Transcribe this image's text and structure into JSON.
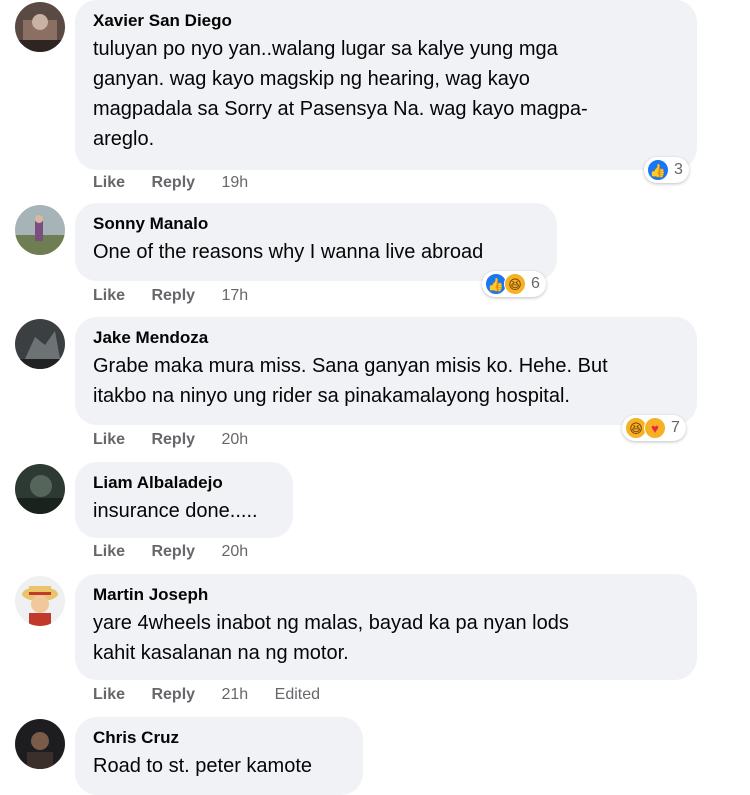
{
  "comments": [
    {
      "author": "Xavier San Diego",
      "text": "tuluyan po nyo yan..walang lugar sa kalye yung mga\nganyan. wag kayo magskip ng hearing, wag kayo\nmagpadala sa Sorry at Pasensya Na. wag kayo magpa-\nareglo.",
      "like": "Like",
      "reply": "Reply",
      "time": "19h",
      "edited": "",
      "reactions": {
        "icons": [
          "like-icon"
        ],
        "count": "3"
      }
    },
    {
      "author": "Sonny Manalo",
      "text": "One of the reasons why I wanna live abroad",
      "like": "Like",
      "reply": "Reply",
      "time": "17h",
      "edited": "",
      "reactions": {
        "icons": [
          "like-icon",
          "haha-icon"
        ],
        "count": "6"
      }
    },
    {
      "author": "Jake Mendoza",
      "text": "Grabe maka mura miss. Sana ganyan misis ko. Hehe. But\nitakbo na ninyo ung rider sa pinakamalayong hospital.",
      "like": "Like",
      "reply": "Reply",
      "time": "20h",
      "edited": "",
      "reactions": {
        "icons": [
          "haha-icon",
          "care-icon"
        ],
        "count": "7"
      }
    },
    {
      "author": "Liam Albaladejo",
      "text": "insurance done.....",
      "like": "Like",
      "reply": "Reply",
      "time": "20h",
      "edited": "",
      "reactions": null
    },
    {
      "author": "Martin Joseph",
      "text": "yare 4wheels inabot ng malas, bayad ka pa nyan lods\nkahit kasalanan na ng motor.",
      "like": "Like",
      "reply": "Reply",
      "time": "21h",
      "edited": "Edited",
      "reactions": null
    },
    {
      "author": "Chris Cruz",
      "text": "Road to st. peter kamote",
      "like": "",
      "reply": "",
      "time": "",
      "edited": "",
      "reactions": null
    }
  ],
  "colors": {
    "bubble": "#f0f2f5",
    "meta_text": "#65676b",
    "like_blue": "#1877f2",
    "haha_yellow": "#f7b125"
  }
}
